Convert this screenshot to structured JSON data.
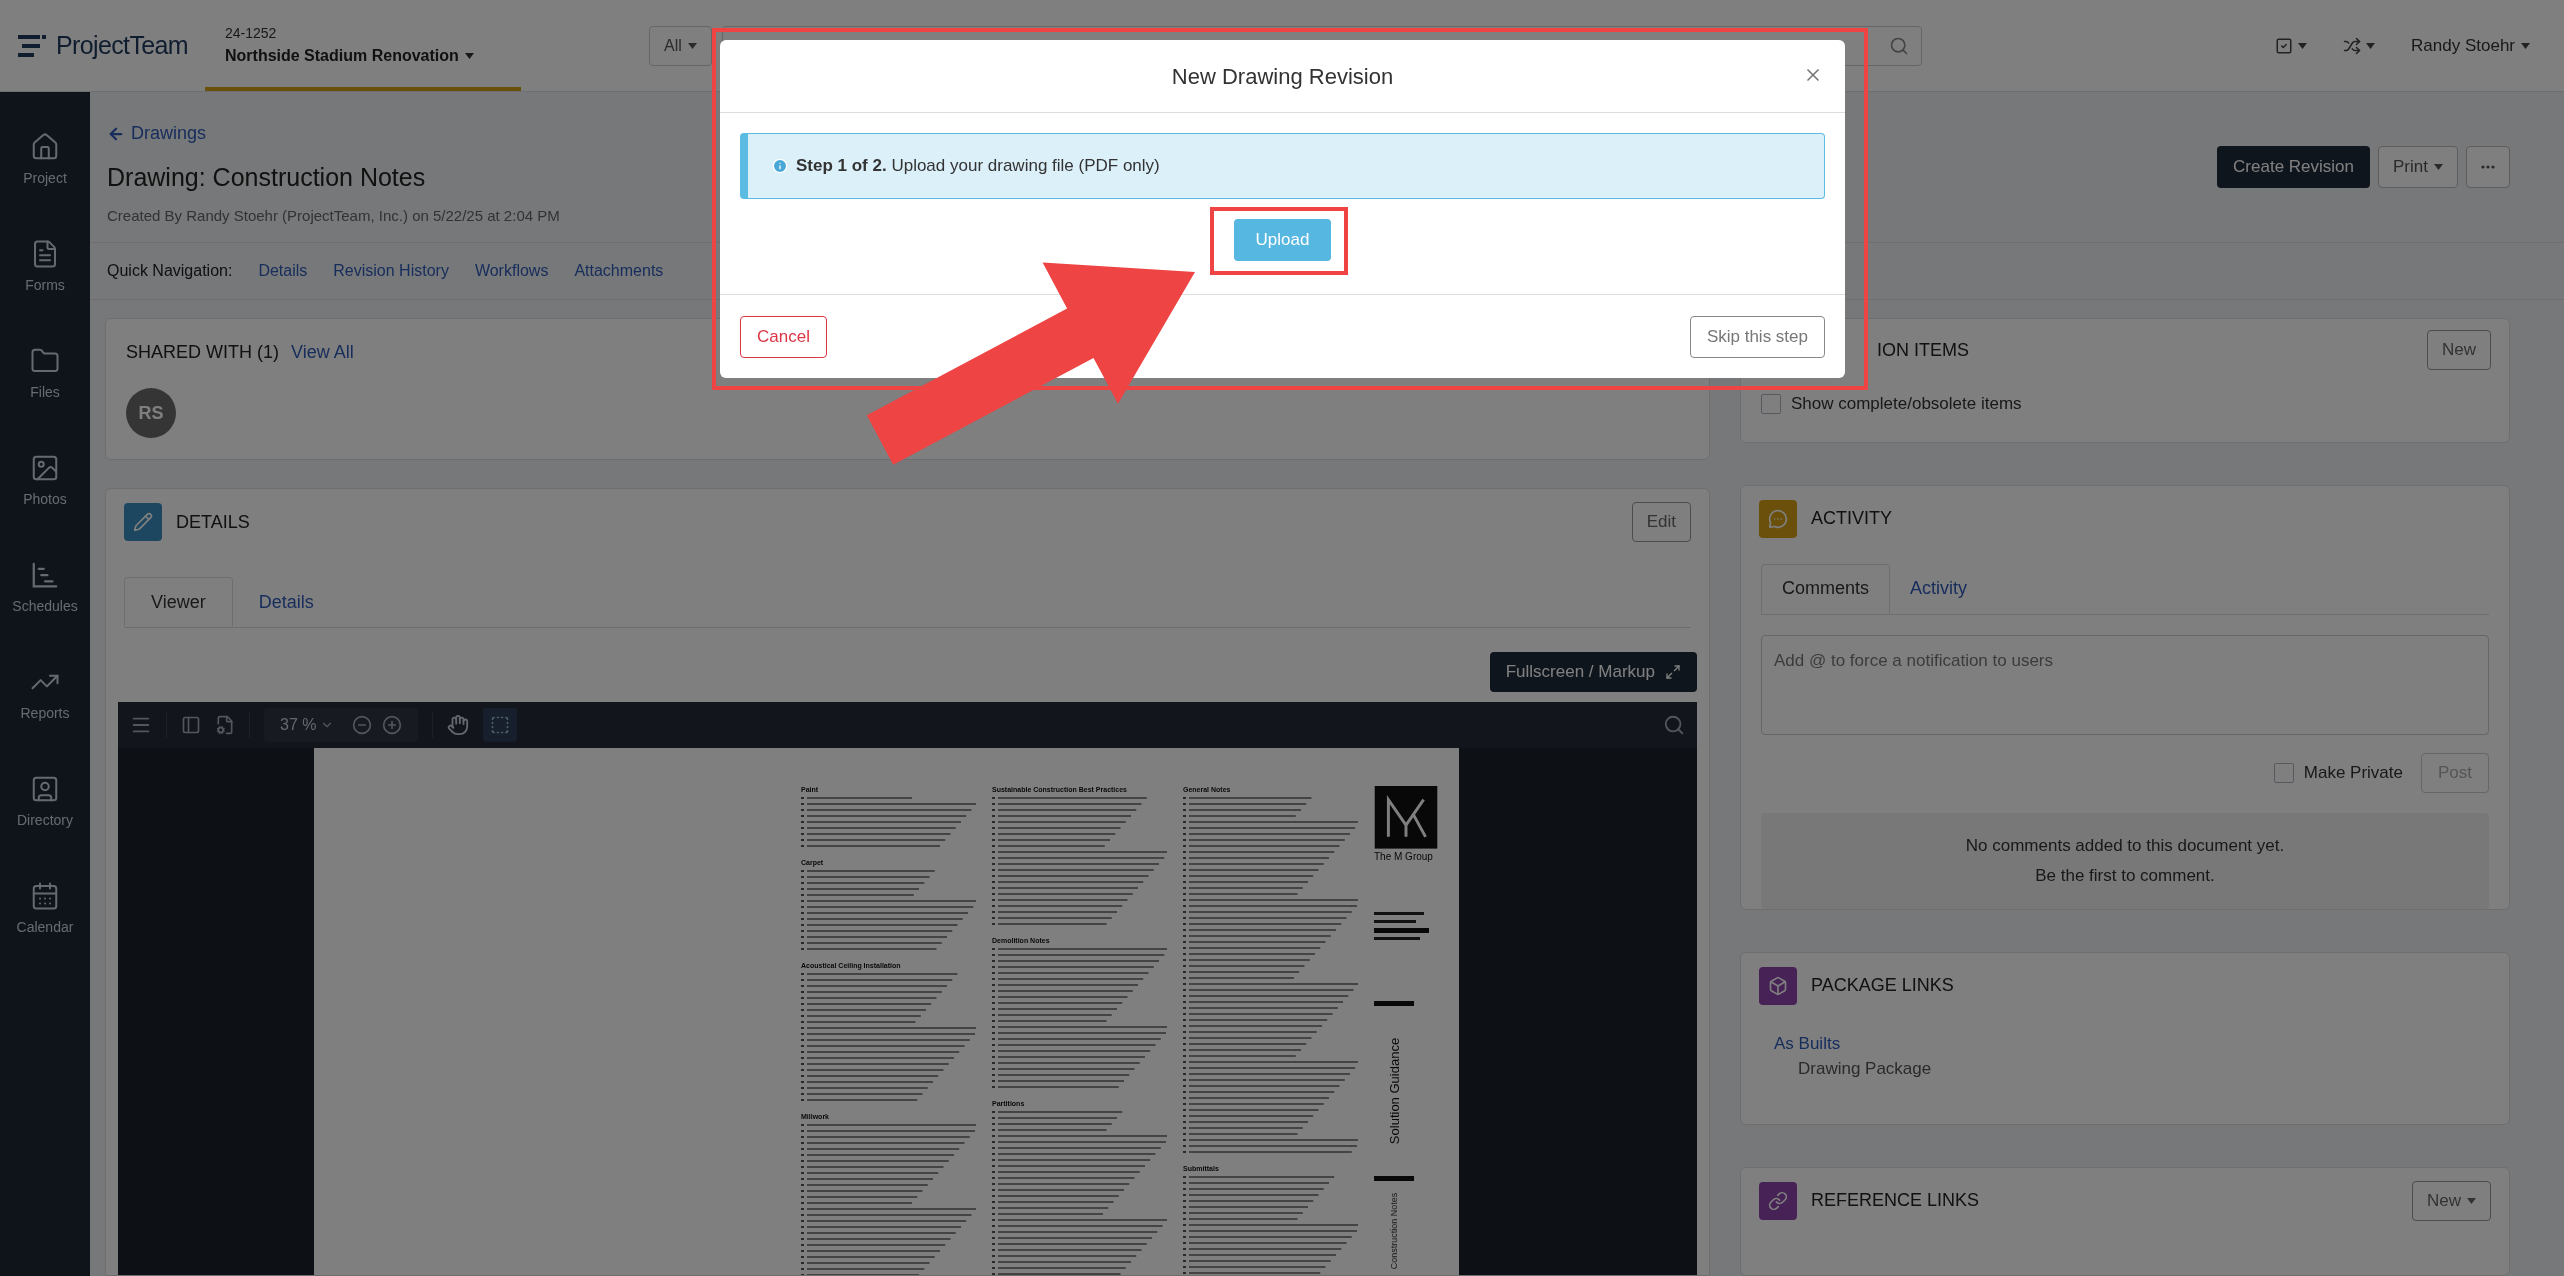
{
  "top_bar": {
    "logo": "ProjectTeam",
    "project_number": "24-1252",
    "project_name": "Northside Stadium Renovation",
    "filter": "All",
    "user": "Randy Stoehr"
  },
  "sidebar": {
    "items": [
      {
        "label": "Project"
      },
      {
        "label": "Forms"
      },
      {
        "label": "Files"
      },
      {
        "label": "Photos"
      },
      {
        "label": "Schedules"
      },
      {
        "label": "Reports"
      },
      {
        "label": "Directory"
      },
      {
        "label": "Calendar"
      }
    ]
  },
  "header": {
    "back_link": "Drawings",
    "title": "Drawing: Construction Notes",
    "created_by": "Created By Randy Stoehr (ProjectTeam, Inc.) on 5/22/25 at 2:04 PM",
    "create_revision": "Create Revision",
    "print": "Print"
  },
  "quick_navigation": {
    "label": "Quick Navigation:",
    "links": [
      "Details",
      "Revision History",
      "Workflows",
      "Attachments"
    ]
  },
  "shared_with": {
    "title": "SHARED WITH (1)",
    "link": "View All",
    "avatars": [
      "RS"
    ]
  },
  "details": {
    "title": "DETAILS",
    "edit": "Edit",
    "tabs": [
      {
        "label": "Viewer",
        "selected": true
      },
      {
        "label": "Details",
        "selected": false
      }
    ],
    "fullscreen": "Fullscreen / Markup",
    "viewer": {
      "zoom": "37 %",
      "columns": [
        {
          "sections": [
            "Paint",
            "Carpet",
            "Acoustical Ceiling Installation",
            "Millwork"
          ]
        },
        {
          "sections": [
            "Sustainable Construction Best Practices",
            "Demolition Notes",
            "Partitions"
          ]
        },
        {
          "sections": [
            "General Notes",
            "Submittals"
          ]
        }
      ],
      "firm": "The M Group",
      "sheet_title": "Solution Guidance",
      "sheet_name": "Construction Notes"
    }
  },
  "action_items": {
    "title": "ION ITEMS",
    "new": "New",
    "show_complete": {
      "label": "Show complete/obsolete items",
      "checked": false
    }
  },
  "activity": {
    "title": "ACTIVITY",
    "tabs": [
      {
        "label": "Comments",
        "selected": true
      },
      {
        "label": "Activity",
        "selected": false
      }
    ],
    "placeholder": "Add @ to force a notification to users",
    "make_private": {
      "label": "Make Private",
      "checked": false
    },
    "post": {
      "label": "Post",
      "disabled": true
    },
    "empty": [
      "No comments added to this document yet.",
      "Be the first to comment."
    ]
  },
  "package_links": {
    "title": "PACKAGE LINKS",
    "items": [
      {
        "name": "As Builts",
        "type": "Drawing Package"
      }
    ]
  },
  "reference_links": {
    "title": "REFERENCE LINKS",
    "new": "New"
  },
  "modal": {
    "title": "New Drawing Revision",
    "alert": "**Step 1 of 2.** Upload your drawing file (PDF only)",
    "upload": "Upload",
    "cancel": "Cancel",
    "skip": "Skip this step"
  }
}
